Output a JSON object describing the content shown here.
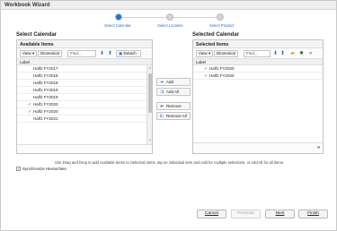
{
  "window": {
    "title": "Workbook Wizard"
  },
  "train": {
    "steps": [
      {
        "label": "Select Calendar",
        "state": "active"
      },
      {
        "label": "Select Location",
        "state": "pending"
      },
      {
        "label": "Select Product",
        "state": "pending"
      }
    ]
  },
  "left": {
    "section_title": "Select Calendar",
    "box_title": "Available Items",
    "toolbar": {
      "view_label": "View",
      "dimension_label": "Dimension",
      "find_placeholder": "Find...",
      "detach_label": "Detach"
    },
    "column_header": "Label",
    "items": [
      {
        "label": "Half2 FY2017",
        "checked": false
      },
      {
        "label": "Half1 FY2018",
        "checked": false
      },
      {
        "label": "Half2 FY2018",
        "checked": false
      },
      {
        "label": "Half1 FY2019",
        "checked": false
      },
      {
        "label": "Half2 FY2019",
        "checked": false
      },
      {
        "label": "Half1 FY2020",
        "checked": true
      },
      {
        "label": "Half2 FY2020",
        "checked": true
      },
      {
        "label": "Half1 FY2021",
        "checked": false
      }
    ]
  },
  "middle": {
    "add_label": "Add",
    "add_all_label": "Add All",
    "remove_label": "Remove",
    "remove_all_label": "Remove All"
  },
  "right": {
    "section_title": "Selected Calendar",
    "box_title": "Selected Items",
    "toolbar": {
      "view_label": "View",
      "dimension_label": "Dimension",
      "find_placeholder": "Find..."
    },
    "column_header": "Label",
    "items": [
      {
        "label": "Half1 FY2020",
        "checked": true
      },
      {
        "label": "Half2 FY2020",
        "checked": true
      }
    ]
  },
  "hint_text": "Use Drag and Drop to add Available Items to Selected Items, tap on individual item and Add for multiple selections, or Add All for all items.",
  "sync": {
    "label": "Synchronize Hierarchies",
    "checked": true
  },
  "buttons": {
    "cancel": "Cancel",
    "previous": "Previous",
    "next": "Next",
    "finish": "Finish"
  },
  "colors": {
    "accent": "#2a6fc9",
    "check": "#2a7a2a"
  }
}
